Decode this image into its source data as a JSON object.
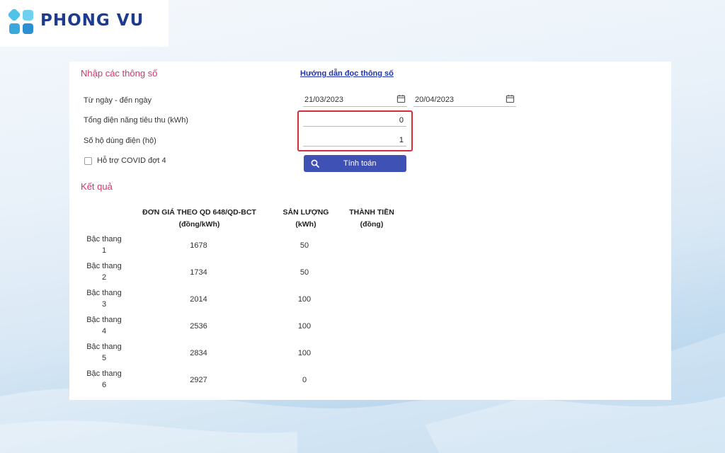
{
  "brand": {
    "name": "PHONG VU"
  },
  "form": {
    "title": "Nhập các thông số",
    "guide_link": "Hướng dẫn đọc thông số",
    "date_range_label": "Từ ngày - đến ngày",
    "from_date": "21/03/2023",
    "to_date": "20/04/2023",
    "consumption_label": "Tổng điện năng tiêu thu (kWh)",
    "consumption_value": "0",
    "households_label": "Số hộ dùng điện (hộ)",
    "households_value": "1",
    "covid_label": "Hỗ trợ COVID đợt 4",
    "calc_button": "Tính toán"
  },
  "result": {
    "title": "Kết quả",
    "headers": {
      "price_line1": "ĐƠN GIÁ THEO QD 648/QD-BCT",
      "price_line2": "(đồng/kWh)",
      "quantity_line1": "SẢN LƯỢNG",
      "quantity_line2": "(kWh)",
      "amount_line1": "THÀNH TIỀN",
      "amount_line2": "(đồng)"
    },
    "rows": [
      {
        "tier": "Bậc thang",
        "num": "1",
        "price": "1678",
        "quantity": "50"
      },
      {
        "tier": "Bậc thang",
        "num": "2",
        "price": "1734",
        "quantity": "50"
      },
      {
        "tier": "Bậc thang",
        "num": "3",
        "price": "2014",
        "quantity": "100"
      },
      {
        "tier": "Bậc thang",
        "num": "4",
        "price": "2536",
        "quantity": "100"
      },
      {
        "tier": "Bậc thang",
        "num": "5",
        "price": "2834",
        "quantity": "100"
      },
      {
        "tier": "Bậc thang",
        "num": "6",
        "price": "2927",
        "quantity": "0"
      }
    ]
  },
  "colors": {
    "accent_title": "#d6336c",
    "button": "#3f51b5",
    "link": "#1f33b5",
    "highlight_border": "#d32f3a",
    "brand_blue": "#1d3b8f"
  },
  "icons": {
    "logo": "phongvu-logo-icon",
    "calendar": "calendar-icon",
    "search": "search-icon",
    "checkbox": "checkbox-icon"
  }
}
